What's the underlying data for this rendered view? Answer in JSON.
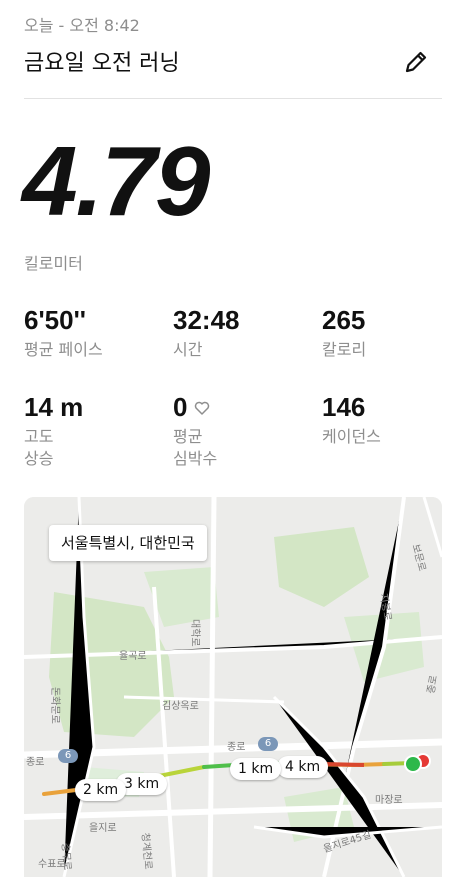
{
  "header": {
    "subtitle": "오늘 - 오전 8:42",
    "title": "금요일 오전 러닝"
  },
  "run": {
    "distance": "4.79",
    "distance_unit": "킬로미터"
  },
  "stats": [
    {
      "value": "6'50''",
      "label": "평균 페이스"
    },
    {
      "value": "32:48",
      "label": "시간"
    },
    {
      "value": "265",
      "label": "칼로리"
    },
    {
      "value": "14 m",
      "label": "고도\n상승"
    },
    {
      "value": "0",
      "label": "평균\n심박수"
    },
    {
      "value": "146",
      "label": "케이던스"
    }
  ],
  "icons": {
    "edit": "pencil-icon",
    "heart": "heart-outline-icon"
  },
  "map": {
    "location": "서울특별시, 대한민국",
    "km_markers": [
      "1 km",
      "4 km",
      "3 km",
      "2 km"
    ],
    "road_labels": [
      "종로",
      "종로",
      "율곡로",
      "김상옥로",
      "대학로",
      "을지로",
      "마장로",
      "을지로45길",
      "충무로",
      "청계천로",
      "지봉로",
      "종로",
      "보문로",
      "수표로",
      "돈화문로"
    ],
    "route_shields": [
      "6",
      "6"
    ],
    "colors": {
      "start": "#2db84a",
      "end": "#e53935",
      "fast": "#5cc24b",
      "medium": "#f0c419",
      "slow": "#e53935"
    }
  }
}
